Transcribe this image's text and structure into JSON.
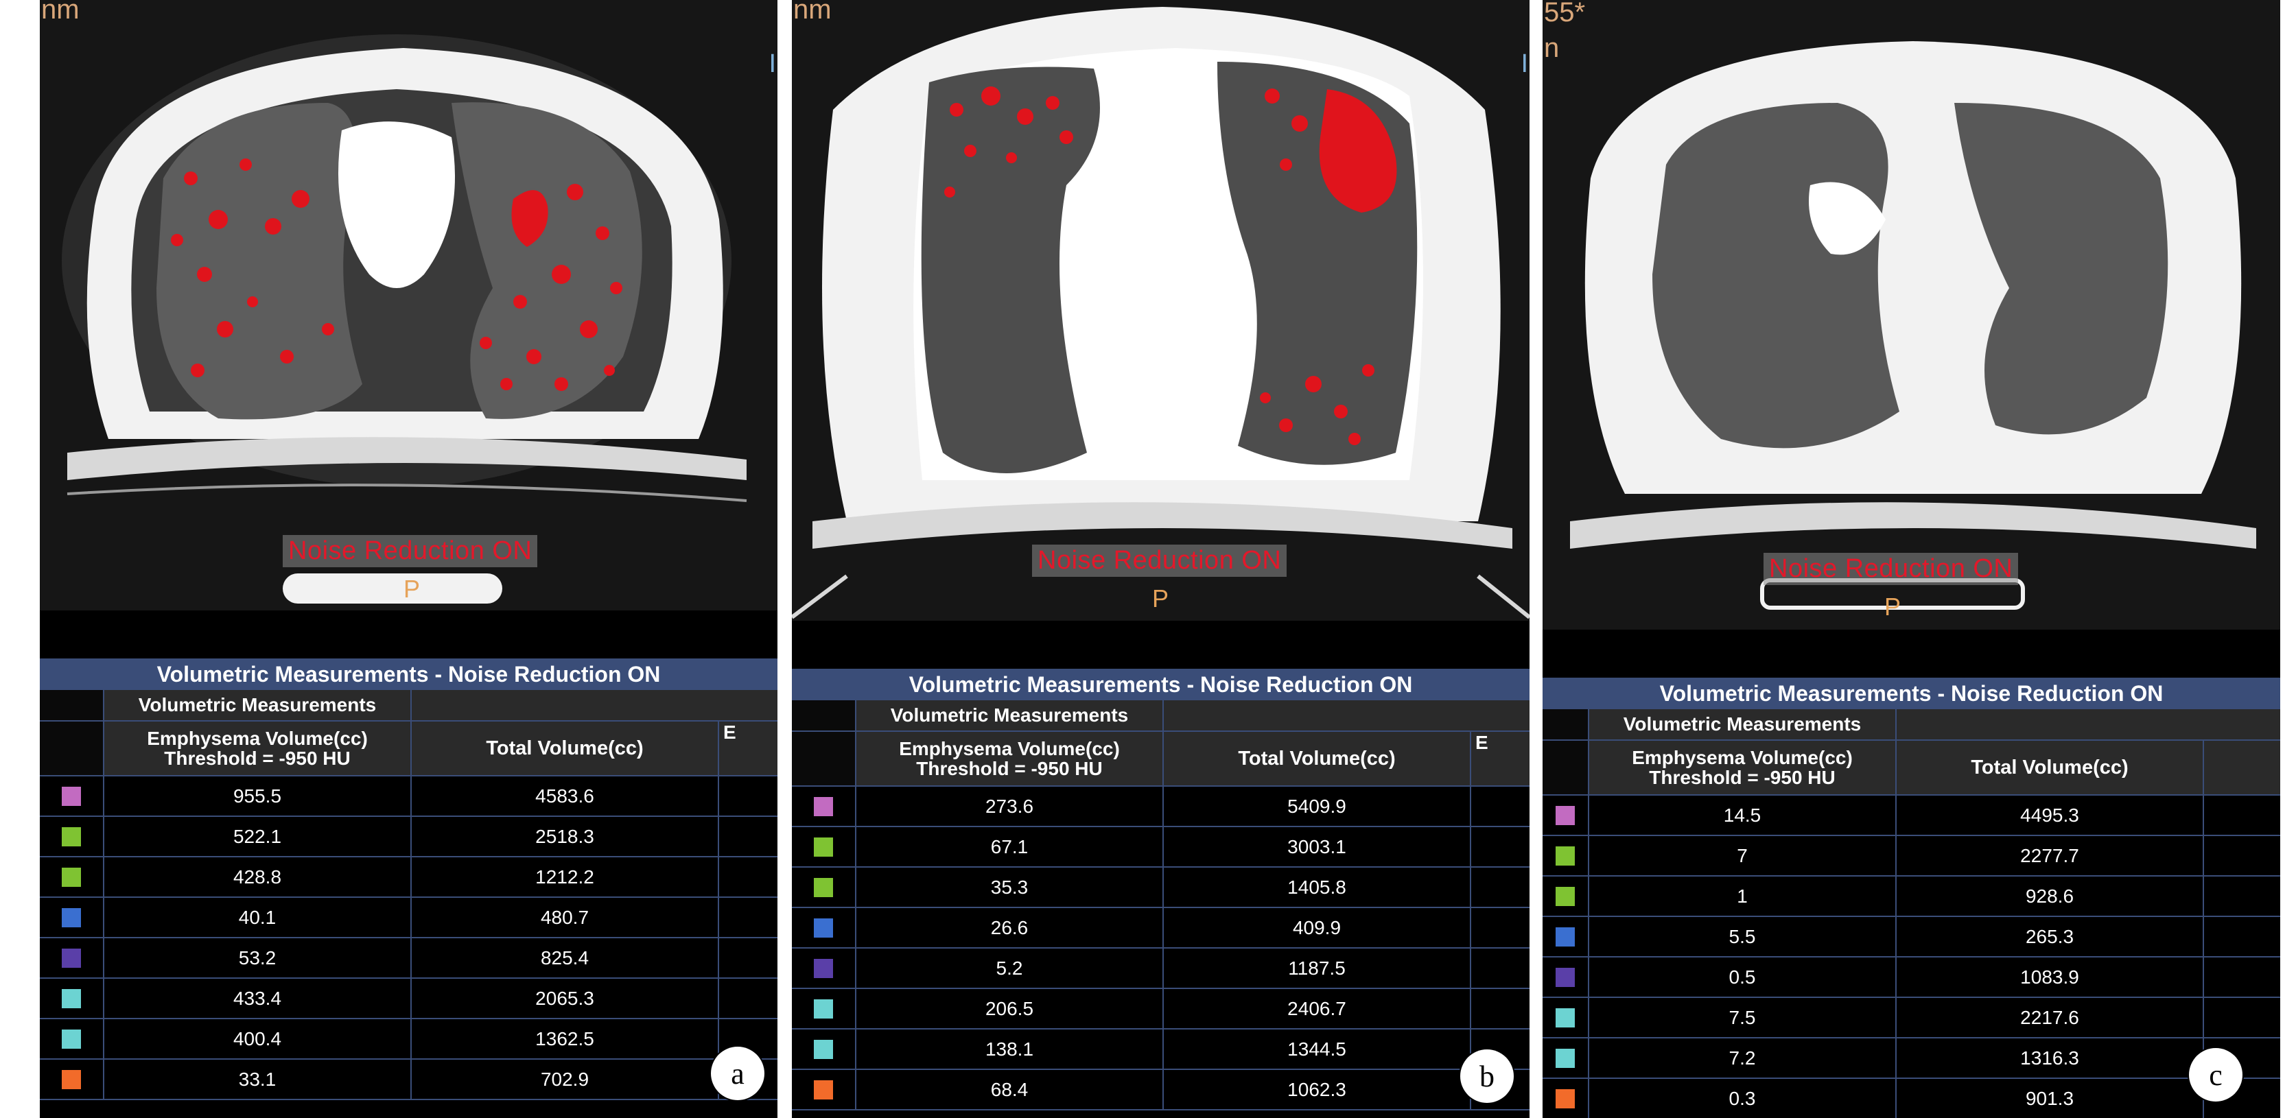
{
  "colors": {
    "title_bar": "#3a4d78",
    "noise_label_text": "#e3182a",
    "swatches": [
      "#c26bc1",
      "#7fc332",
      "#7fc332",
      "#3a6fd0",
      "#5a3fa8",
      "#6cd3d2",
      "#6cd3d2",
      "#f26b2a"
    ]
  },
  "common": {
    "noise_label": "Noise Reduction ON",
    "p_marker": "P",
    "table_title": "Volumetric Measurements - Noise Reduction ON",
    "group_header": "Volumetric Measurements",
    "col1_line1": "Emphysema Volume(cc)",
    "col1_line2": "Threshold = -950 HU",
    "col2": "Total Volume(cc)",
    "col3_fragment": "E"
  },
  "panels": [
    {
      "badge": "a",
      "corner_text": "nm",
      "side_text": "I",
      "rows": [
        {
          "emphysema": "955.5",
          "total": "4583.6"
        },
        {
          "emphysema": "522.1",
          "total": "2518.3"
        },
        {
          "emphysema": "428.8",
          "total": "1212.2"
        },
        {
          "emphysema": "40.1",
          "total": "480.7"
        },
        {
          "emphysema": "53.2",
          "total": "825.4"
        },
        {
          "emphysema": "433.4",
          "total": "2065.3"
        },
        {
          "emphysema": "400.4",
          "total": "1362.5"
        },
        {
          "emphysema": "33.1",
          "total": "702.9"
        }
      ]
    },
    {
      "badge": "b",
      "corner_text": "nm",
      "side_text": "I",
      "rows": [
        {
          "emphysema": "273.6",
          "total": "5409.9"
        },
        {
          "emphysema": "67.1",
          "total": "3003.1"
        },
        {
          "emphysema": "35.3",
          "total": "1405.8"
        },
        {
          "emphysema": "26.6",
          "total": "409.9"
        },
        {
          "emphysema": "5.2",
          "total": "1187.5"
        },
        {
          "emphysema": "206.5",
          "total": "2406.7"
        },
        {
          "emphysema": "138.1",
          "total": "1344.5"
        },
        {
          "emphysema": "68.4",
          "total": "1062.3"
        }
      ]
    },
    {
      "badge": "c",
      "corner_text": "55*\nn",
      "side_text": "",
      "rows": [
        {
          "emphysema": "14.5",
          "total": "4495.3"
        },
        {
          "emphysema": "7",
          "total": "2277.7"
        },
        {
          "emphysema": "1",
          "total": "928.6"
        },
        {
          "emphysema": "5.5",
          "total": "265.3"
        },
        {
          "emphysema": "0.5",
          "total": "1083.9"
        },
        {
          "emphysema": "7.5",
          "total": "2217.6"
        },
        {
          "emphysema": "7.2",
          "total": "1316.3"
        },
        {
          "emphysema": "0.3",
          "total": "901.3"
        }
      ]
    }
  ]
}
